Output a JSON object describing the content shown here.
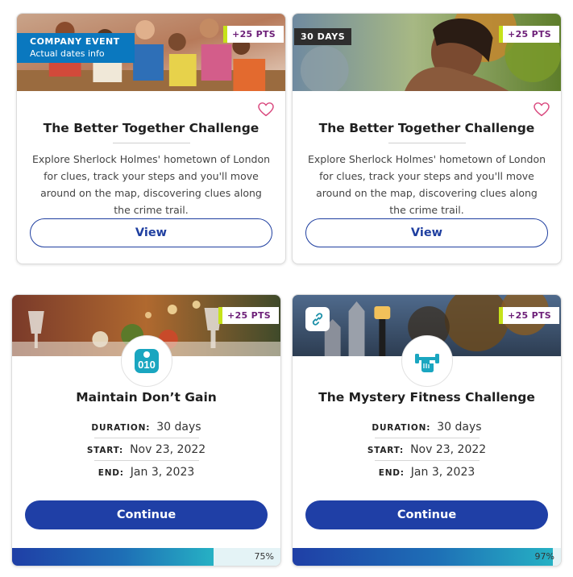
{
  "cards": [
    {
      "points": "+25 PTS",
      "event_badge": {
        "line1": "COMPANY EVENT",
        "line2": "Actual dates info"
      },
      "title": "The Better Together Challenge",
      "description": "Explore Sherlock Holmes' hometown of London for clues, track your steps and you'll move around on the map, discovering clues along the crime trail.",
      "button": "View"
    },
    {
      "points": "+25 PTS",
      "days_badge": "30 DAYS",
      "title": "The Better Together Challenge",
      "description": "Explore Sherlock Holmes' hometown of London for clues, track your steps and you'll move around on the map, discovering clues along the crime trail.",
      "button": "View"
    },
    {
      "points": "+25 PTS",
      "icon": "scale-icon",
      "title": "Maintain Don’t Gain",
      "duration_label": "DURATION:",
      "duration": "30 days",
      "start_label": "START:",
      "start": "Nov 23, 2022",
      "end_label": "END:",
      "end": "Jan 3, 2023",
      "button": "Continue",
      "progress": 75,
      "progress_label": "75%"
    },
    {
      "points": "+25 PTS",
      "icon": "dumbbell-hand-icon",
      "link_icon": "link-icon",
      "title": "The Mystery Fitness Challenge",
      "duration_label": "DURATION:",
      "duration": "30 days",
      "start_label": "START:",
      "start": "Nov 23, 2022",
      "end_label": "END:",
      "end": "Jan 3, 2023",
      "button": "Continue",
      "progress": 97,
      "progress_label": "97%"
    }
  ],
  "colors": {
    "primary": "#1f3fa6",
    "points_text": "#6d1f78",
    "points_accent": "#c6e21a",
    "company_badge": "#0a78bf",
    "icon_teal": "#1aa6c0",
    "heart": "#d9477d"
  }
}
